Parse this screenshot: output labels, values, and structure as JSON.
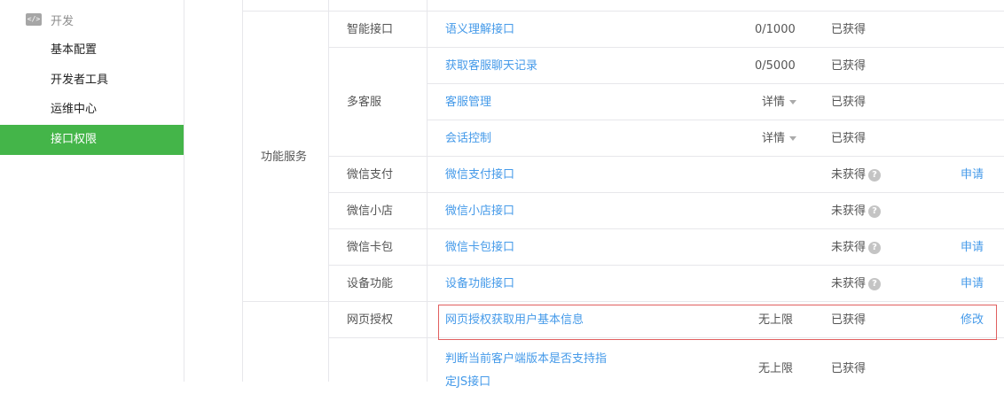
{
  "sidebar": {
    "section_icon": "code-icon",
    "section_icon_glyph": "</>",
    "section_label": "开发",
    "items": [
      {
        "label": "基本配置"
      },
      {
        "label": "开发者工具"
      },
      {
        "label": "运维中心"
      },
      {
        "label": "接口权限",
        "active": true
      }
    ]
  },
  "table": {
    "group_label": "功能服务",
    "rows": [
      {
        "category": "智能接口",
        "name": "语义理解接口",
        "quota": "0/1000",
        "status": "已获得",
        "action": ""
      },
      {
        "category": "多客服",
        "name": "获取客服聊天记录",
        "quota": "0/5000",
        "status": "已获得",
        "action": ""
      },
      {
        "category": "",
        "name": "客服管理",
        "quota": "详情",
        "status": "已获得",
        "action": ""
      },
      {
        "category": "",
        "name": "会话控制",
        "quota": "详情",
        "status": "已获得",
        "action": ""
      },
      {
        "category": "微信支付",
        "name": "微信支付接口",
        "quota": "",
        "status": "未获得",
        "action": "申请"
      },
      {
        "category": "微信小店",
        "name": "微信小店接口",
        "quota": "",
        "status": "未获得",
        "action": ""
      },
      {
        "category": "微信卡包",
        "name": "微信卡包接口",
        "quota": "",
        "status": "未获得",
        "action": "申请"
      },
      {
        "category": "设备功能",
        "name": "设备功能接口",
        "quota": "",
        "status": "未获得",
        "action": "申请"
      },
      {
        "category": "网页授权",
        "name": "网页授权获取用户基本信息",
        "quota": "无上限",
        "status": "已获得",
        "action": "修改"
      },
      {
        "category": "",
        "name_line1": "判断当前客户端版本是否支持指",
        "name_line2": "定JS接口",
        "quota": "无上限",
        "status": "已获得",
        "action": ""
      }
    ],
    "help_icon": "question-icon",
    "help_glyph": "?",
    "dropdown_icon": "chevron-down-icon"
  },
  "colors": {
    "accent": "#44b549",
    "link": "#459ae9",
    "highlight": "#e15f5f",
    "border": "#e7e7eb"
  }
}
